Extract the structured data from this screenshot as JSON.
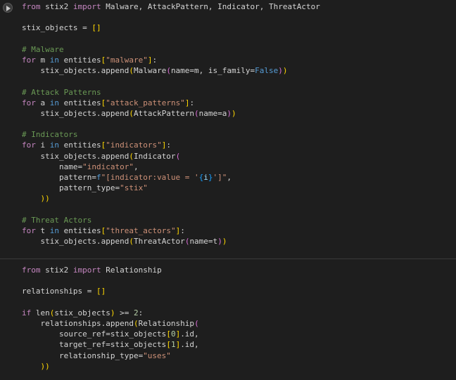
{
  "cells": [
    {
      "lines": [
        "from stix2 import Malware, AttackPattern, Indicator, ThreatActor",
        "",
        "stix_objects = []",
        "",
        "# Malware",
        "for m in entities[\"malware\"]:",
        "    stix_objects.append(Malware(name=m, is_family=False))",
        "",
        "# Attack Patterns",
        "for a in entities[\"attack_patterns\"]:",
        "    stix_objects.append(AttackPattern(name=a))",
        "",
        "# Indicators",
        "for i in entities[\"indicators\"]:",
        "    stix_objects.append(Indicator(",
        "        name=\"indicator\",",
        "        pattern=f\"[indicator:value = '{i}']\",",
        "        pattern_type=\"stix\"",
        "    ))",
        "",
        "# Threat Actors",
        "for t in entities[\"threat_actors\"]:",
        "    stix_objects.append(ThreatActor(name=t))"
      ]
    },
    {
      "lines": [
        "from stix2 import Relationship",
        "",
        "relationships = []",
        "",
        "if len(stix_objects) >= 2:",
        "    relationships.append(Relationship(",
        "        source_ref=stix_objects[0].id,",
        "        target_ref=stix_objects[1].id,",
        "        relationship_type=\"uses\"",
        "    ))"
      ]
    }
  ],
  "colors": {
    "background": "#1e1e1e",
    "text": "#d4d4d4",
    "keyword": "#569cd6",
    "control": "#c586c0",
    "string": "#ce9178",
    "comment": "#6a9955",
    "number": "#b5cea8"
  },
  "icons": {
    "run": "play-icon"
  }
}
